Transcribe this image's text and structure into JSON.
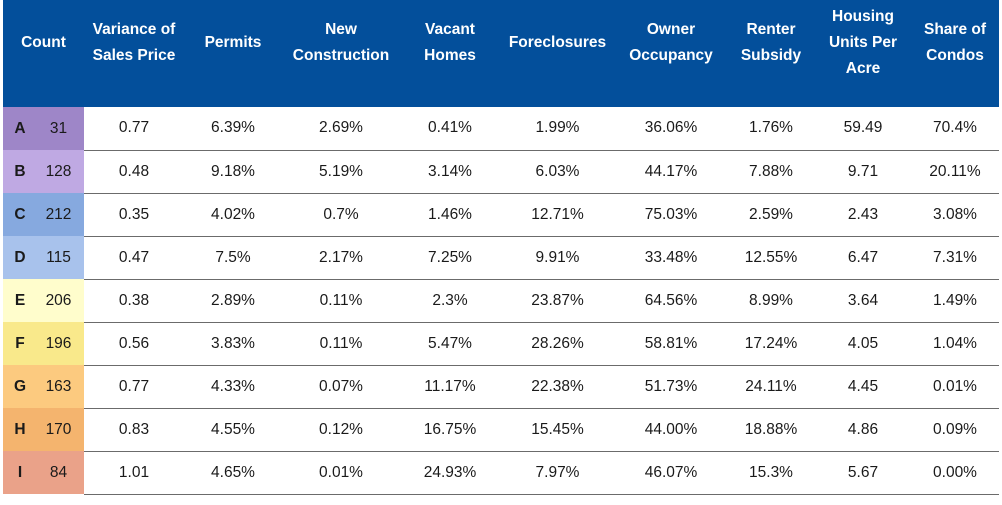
{
  "table": {
    "headers": [
      "Count",
      "Variance of Sales Price",
      "Permits",
      "New Construction",
      "Vacant Homes",
      "Foreclosures",
      "Owner Occupancy",
      "Renter Subsidy",
      "Housing Units Per Acre",
      "Share of Condos"
    ],
    "header_color": "#034f9b",
    "rows": [
      {
        "letter": "A",
        "count": "31",
        "color": "#9e86c8",
        "values": [
          "0.77",
          "6.39%",
          "2.69%",
          "0.41%",
          "1.99%",
          "36.06%",
          "1.76%",
          "59.49",
          "70.4%"
        ]
      },
      {
        "letter": "B",
        "count": "128",
        "color": "#bfa9e3",
        "values": [
          "0.48",
          "9.18%",
          "5.19%",
          "3.14%",
          "6.03%",
          "44.17%",
          "7.88%",
          "9.71",
          "20.11%"
        ]
      },
      {
        "letter": "C",
        "count": "212",
        "color": "#86a9df",
        "values": [
          "0.35",
          "4.02%",
          "0.7%",
          "1.46%",
          "12.71%",
          "75.03%",
          "2.59%",
          "2.43",
          "3.08%"
        ]
      },
      {
        "letter": "D",
        "count": "115",
        "color": "#a8c2ec",
        "values": [
          "0.47",
          "7.5%",
          "2.17%",
          "7.25%",
          "9.91%",
          "33.48%",
          "12.55%",
          "6.47",
          "7.31%"
        ]
      },
      {
        "letter": "E",
        "count": "206",
        "color": "#fffdcc",
        "values": [
          "0.38",
          "2.89%",
          "0.11%",
          "2.3%",
          "23.87%",
          "64.56%",
          "8.99%",
          "3.64",
          "1.49%"
        ]
      },
      {
        "letter": "F",
        "count": "196",
        "color": "#f9e98b",
        "values": [
          "0.56",
          "3.83%",
          "0.11%",
          "5.47%",
          "28.26%",
          "58.81%",
          "17.24%",
          "4.05",
          "1.04%"
        ]
      },
      {
        "letter": "G",
        "count": "163",
        "color": "#fcca7f",
        "values": [
          "0.77",
          "4.33%",
          "0.07%",
          "11.17%",
          "22.38%",
          "51.73%",
          "24.11%",
          "4.45",
          "0.01%"
        ]
      },
      {
        "letter": "H",
        "count": "170",
        "color": "#f4b46e",
        "values": [
          "0.83",
          "4.55%",
          "0.12%",
          "16.75%",
          "15.45%",
          "44.00%",
          "18.88%",
          "4.86",
          "0.09%"
        ]
      },
      {
        "letter": "I",
        "count": "84",
        "color": "#eaa289",
        "values": [
          "1.01",
          "4.65%",
          "0.01%",
          "24.93%",
          "7.97%",
          "46.07%",
          "15.3%",
          "5.67",
          "0.00%"
        ]
      }
    ]
  }
}
